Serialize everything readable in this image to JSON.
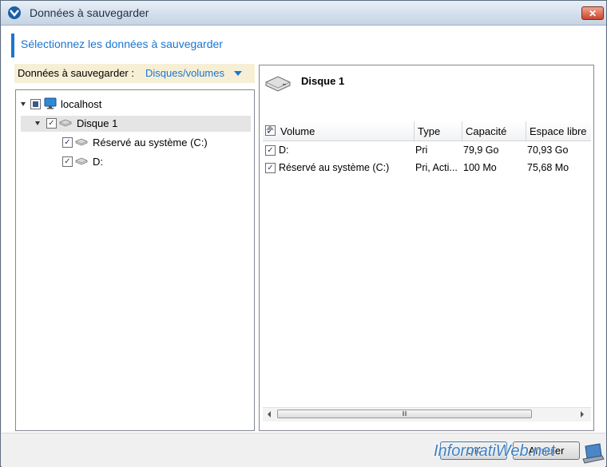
{
  "window": {
    "title": "Données à sauvegarder"
  },
  "heading": "Sélectionnez les données à sauvegarder",
  "selector": {
    "label": "Données à sauvegarder :",
    "value": "Disques/volumes"
  },
  "tree": {
    "root": {
      "label": "localhost"
    },
    "disk": {
      "label": "Disque 1"
    },
    "volumes": [
      {
        "label": "Réservé au système (C:)"
      },
      {
        "label": "D:"
      }
    ]
  },
  "details": {
    "title": "Disque 1",
    "columns": [
      "Volume",
      "Type",
      "Capacité",
      "Espace libre"
    ],
    "rows": [
      {
        "volume": "D:",
        "type": "Pri",
        "capacity": "79,9 Go",
        "free": "70,93 Go"
      },
      {
        "volume": "Réservé au système (C:)",
        "type": "Pri, Acti...",
        "capacity": "100 Mo",
        "free": "75,68 Mo"
      }
    ]
  },
  "buttons": {
    "ok": "OK",
    "cancel": "Annuler"
  },
  "watermark": "InformatiWeb.net",
  "colors": {
    "accent": "#1b76d1",
    "selector_bg": "#f6efd6"
  }
}
